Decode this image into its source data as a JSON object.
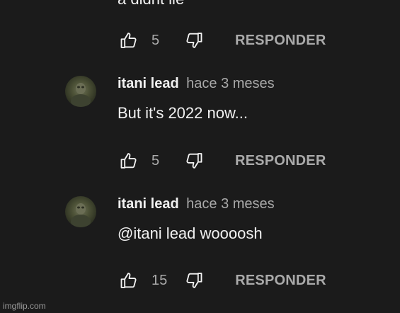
{
  "top_comment": {
    "clipped_text": "a didnt lie",
    "likes": "5",
    "reply_label": "RESPONDER"
  },
  "replies": [
    {
      "author": "itani lead",
      "time": "hace 3 meses",
      "text": "But it's 2022 now...",
      "likes": "5",
      "reply_label": "RESPONDER"
    },
    {
      "author": "itani lead",
      "time": "hace 3 meses",
      "text": "@itani lead woooosh",
      "likes": "15",
      "reply_label": "RESPONDER"
    }
  ],
  "watermark": "imgflip.com",
  "colors": {
    "background": "#1b1b1b",
    "primary_text": "#f1f1f1",
    "secondary_text": "#aaaaaa"
  },
  "icons": {
    "like": "thumb-up-outline-icon",
    "dislike": "thumb-down-outline-icon"
  }
}
